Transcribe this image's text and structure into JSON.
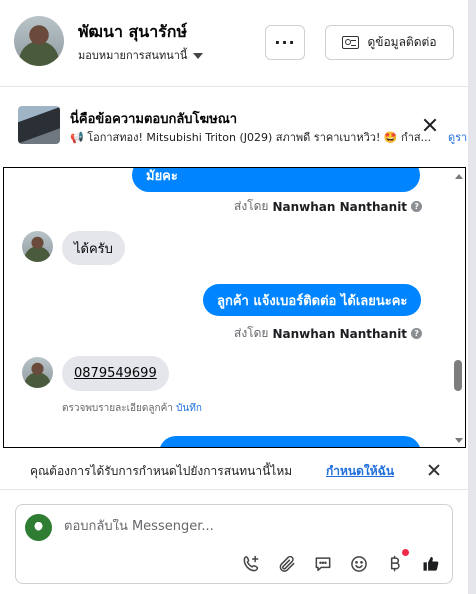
{
  "header": {
    "name": "พัฒนา สุนารักษ์",
    "assign_label": "มอบหมายการสนทนานี้",
    "more_label": "···",
    "contact_info_label": "ดูข้อมูลติดต่อ"
  },
  "ad": {
    "title": "นี่คือข้อความตอบกลับโฆษณา",
    "text": "📢 โอกาสทอง! Mitsubishi Triton (J029) สภาพดี ราคาเบาหวิว! 🤩 กำส...",
    "link": "ดูรา"
  },
  "conversation": {
    "messages": [
      {
        "direction": "out",
        "text": "มัยคะ"
      },
      {
        "sent_by_prefix": "ส่งโดย",
        "sent_by_name": "Nanwhan Nanthanit"
      },
      {
        "direction": "in",
        "text": "ได้ครับ"
      },
      {
        "direction": "out",
        "text": "ลูกค้า แจ้งเบอร์ติดต่อ ได้เลยนะคะ"
      },
      {
        "sent_by_prefix": "ส่งโดย",
        "sent_by_name": "Nanwhan Nanthanit"
      },
      {
        "direction": "in",
        "text": "0879549699"
      },
      {
        "detect_text": "ตรวจพบรายละเอียดลูกค้า",
        "detect_link": "บันทึก"
      }
    ]
  },
  "assign_prompt": {
    "question": "คุณต้องการได้รับการกำหนดไปยังการสนทนานี้ไหม",
    "action": "กำหนดให้ฉัน"
  },
  "composer": {
    "placeholder": "ตอบกลับใน Messenger...",
    "tools": [
      "phone-plus-icon",
      "paperclip-icon",
      "chat-bubble-icon",
      "emoji-icon",
      "baht-icon",
      "thumbs-up-icon"
    ]
  },
  "colors": {
    "accent": "#0084ff",
    "link": "#216fdb",
    "incoming_bubble": "#e4e6eb"
  }
}
